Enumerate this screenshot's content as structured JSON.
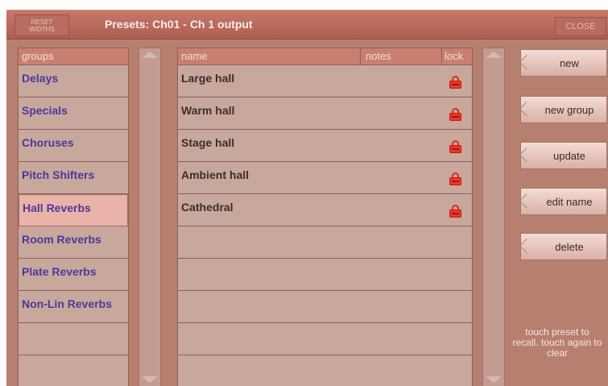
{
  "titlebar": {
    "reset_label": "RESET\nWIDTHS",
    "title": "Presets: Ch01 - Ch 1 output",
    "close_label": "CLOSE"
  },
  "groups": {
    "header": "groups",
    "items": [
      {
        "label": "Delays"
      },
      {
        "label": "Specials"
      },
      {
        "label": "Choruses"
      },
      {
        "label": "Pitch Shifters"
      },
      {
        "label": "Hall Reverbs"
      },
      {
        "label": "Room Reverbs"
      },
      {
        "label": "Plate Reverbs"
      },
      {
        "label": "Non-Lin Reverbs"
      },
      {
        "label": ""
      },
      {
        "label": ""
      }
    ],
    "selected": "Hall Reverbs"
  },
  "presets": {
    "columns": {
      "name": "name",
      "notes": "notes",
      "lock": "lock"
    },
    "rows": [
      {
        "name": "Large hall",
        "notes": "",
        "locked": true
      },
      {
        "name": "Warm hall",
        "notes": "",
        "locked": true
      },
      {
        "name": "Stage hall",
        "notes": "",
        "locked": true
      },
      {
        "name": "Ambient hall",
        "notes": "",
        "locked": true
      },
      {
        "name": "Cathedral",
        "notes": "",
        "locked": true
      },
      {
        "name": "",
        "notes": "",
        "locked": false
      },
      {
        "name": "",
        "notes": "",
        "locked": false
      },
      {
        "name": "",
        "notes": "",
        "locked": false
      },
      {
        "name": "",
        "notes": "",
        "locked": false
      },
      {
        "name": "",
        "notes": "",
        "locked": false
      }
    ]
  },
  "actions": {
    "new": "new",
    "new_group": "new group",
    "update": "update",
    "edit_name": "edit name",
    "delete": "delete"
  },
  "hint": "touch preset to recall. touch again to clear",
  "colors": {
    "panel": "#b77f70",
    "titlebar": "#c8786a",
    "list_bg": "#c8a79c",
    "group_text": "#4b3a9a",
    "selected_row": "#e9b3a9",
    "lock_red": "#f0342a"
  },
  "icons": {
    "lock": "lock-icon",
    "chevron": "chevron-left-icon",
    "scroll_up": "arrow-up-icon",
    "scroll_down": "arrow-down-icon"
  }
}
